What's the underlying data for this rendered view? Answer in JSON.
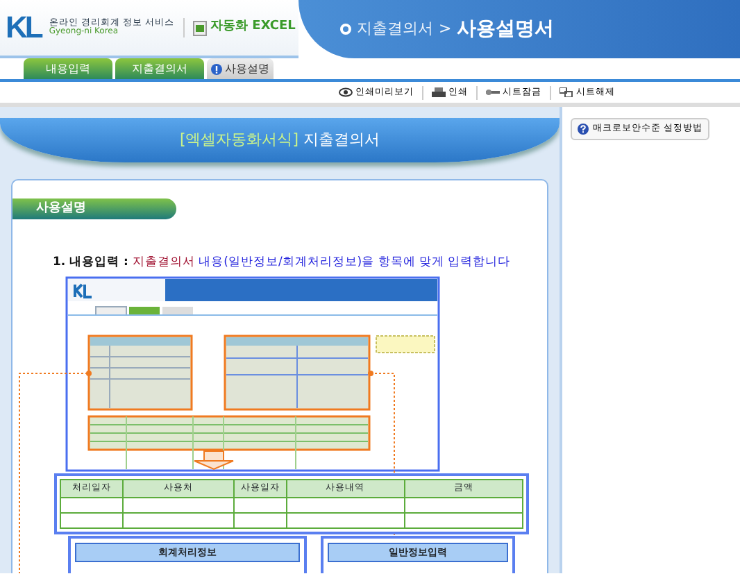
{
  "header": {
    "logo_mark": "KL",
    "logo_title": "온라인 경리회계 정보 서비스",
    "logo_subtitle": "Gyeong-ni Korea",
    "product": "자동화 EXCEL",
    "breadcrumb_parent": "지출결의서",
    "breadcrumb_separator": ">",
    "breadcrumb_current": "사용설명서"
  },
  "tabs": [
    {
      "label": "내용입력",
      "selected": false
    },
    {
      "label": "지출결의서",
      "selected": false
    },
    {
      "label": "사용설명",
      "selected": true
    }
  ],
  "toolbar": [
    {
      "kind": "preview",
      "label": "인쇄미리보기"
    },
    {
      "kind": "print",
      "label": "인쇄"
    },
    {
      "kind": "lock",
      "label": "시트잠금"
    },
    {
      "kind": "unlock",
      "label": "시트해제"
    }
  ],
  "side_button": "매크로보안수준 설정방법",
  "banner": {
    "prefix": "[엑셀자동화서식]",
    "title": "지출결의서"
  },
  "section_title": "사용설명",
  "step": {
    "number": "1. 내용입력 :",
    "highlight": "지출결의서",
    "text": "내용(일반정보/회계처리정보)을 항목에 맞게 입력합니다"
  },
  "enlarged_table": {
    "columns": [
      "처리일자",
      "사용처",
      "사용일자",
      "사용내역",
      "금액"
    ]
  },
  "bottom_panels": [
    "회계처리정보",
    "일반정보입력"
  ]
}
